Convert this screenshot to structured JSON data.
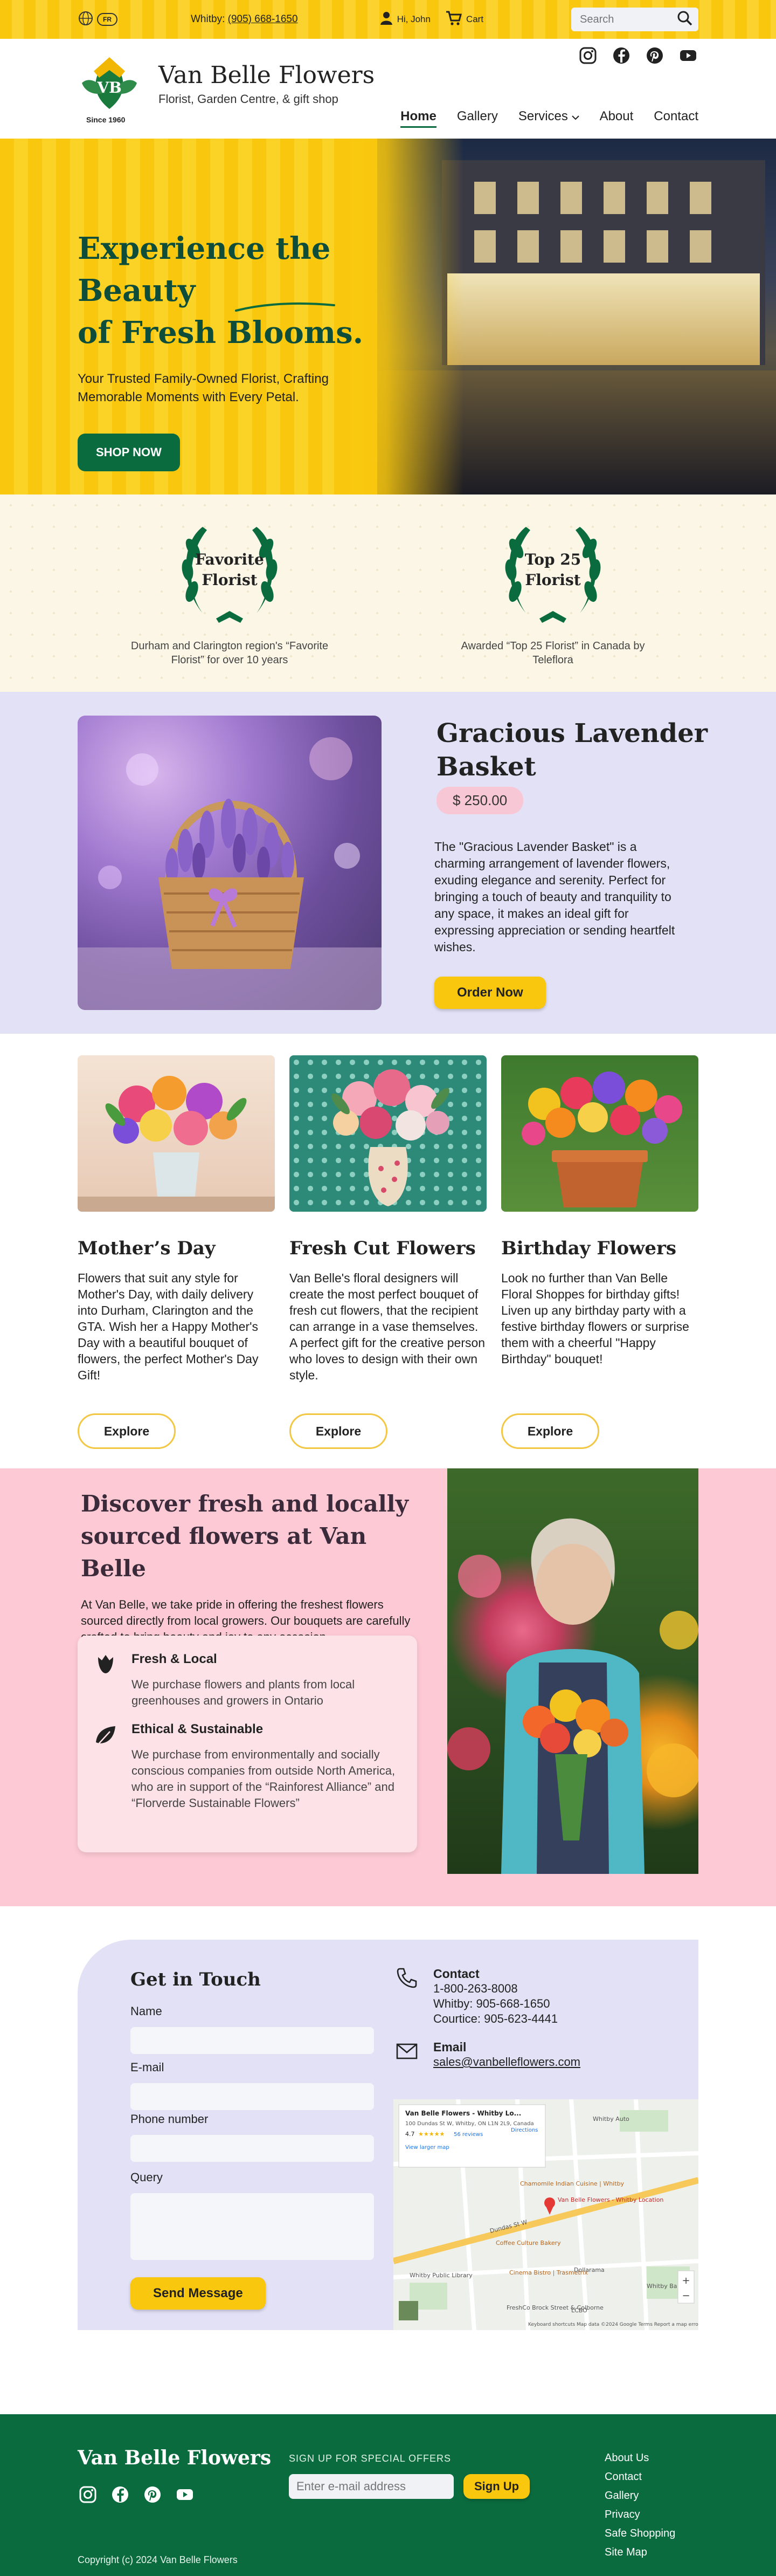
{
  "colors": {
    "brand_green": "#0a6b3e",
    "accent_yellow": "#f9c80e",
    "lavender_bg": "#e3e1f6",
    "pink_bg": "#fcc9d4"
  },
  "topbar": {
    "lang": "FR",
    "phone_prefix": "Whitby: ",
    "phone": "(905) 668-1650",
    "user": "Hi, John",
    "cart": "Cart",
    "search_placeholder": "Search"
  },
  "header": {
    "logo_letters": "VB",
    "since": "Since 1960",
    "name": "Van Belle Flowers",
    "tagline": "Florist, Garden Centre, & gift shop",
    "nav": [
      "Home",
      "Gallery",
      "Services",
      "About",
      "Contact"
    ]
  },
  "hero": {
    "title_line1": "Experience the Beauty",
    "title_line2": "of Fresh Blooms.",
    "subtitle": "Your Trusted Family-Owned Florist, Crafting Memorable Moments with Every Petal.",
    "cta": "SHOP NOW"
  },
  "awards": [
    {
      "badge_line1": "Favorite",
      "badge_line2": "Florist",
      "desc": "Durham and Clarington region's “Favorite Florist” for over 10 years"
    },
    {
      "badge_line1": "Top 25",
      "badge_line2": "Florist",
      "desc": "Awarded “Top 25 Florist” in Canada by Teleflora"
    }
  ],
  "featured": {
    "title": "Gracious Lavender Basket",
    "price": "$ 250.00",
    "desc": "The \"Gracious Lavender Basket\" is a charming arrangement of lavender flowers, exuding elegance and serenity. Perfect for bringing a touch of beauty and tranquility to any space, it makes an ideal gift for expressing appreciation or sending heartfelt wishes.",
    "cta": "Order Now"
  },
  "categories": [
    {
      "title": "Mother’s Day",
      "desc": "Flowers that suit any style for Mother's Day, with daily delivery into Durham, Clarington and the GTA.  Wish her a Happy Mother's Day with a beautiful bouquet of flowers, the perfect Mother's Day Gift!",
      "cta": "Explore"
    },
    {
      "title": "Fresh Cut Flowers",
      "desc": "Van Belle's floral designers will create the most perfect bouquet of fresh cut flowers, that the recipient can arrange in a vase themselves. A perfect gift for the creative person who loves to design with their own style.",
      "cta": "Explore"
    },
    {
      "title": "Birthday Flowers",
      "desc": "Look no further than Van Belle Floral Shoppes for birthday gifts! Liven up any birthday party with a festive birthday flowers or surprise them with a cheerful \"Happy Birthday\" bouquet!",
      "cta": "Explore"
    }
  ],
  "local": {
    "title": "Discover fresh and locally sourced flowers at Van Belle",
    "intro": "At Van Belle, we take pride in offering the freshest flowers sourced directly from local growers. Our bouquets are carefully crafted to bring beauty and joy to any occasion.",
    "items": [
      {
        "title": "Fresh & Local",
        "text": "We purchase flowers and plants from local greenhouses and growers in Ontario"
      },
      {
        "title": "Ethical & Sustainable",
        "text": "We purchase from environmentally and socially conscious companies from outside North America, who are in support of the “Rainforest Alliance” and “Florverde Sustainable Flowers”"
      }
    ]
  },
  "contact": {
    "title": "Get in Touch",
    "fields": [
      "Name",
      "E-mail",
      "Phone number",
      "Query"
    ],
    "send": "Send Message",
    "phone_title": "Contact",
    "phone_lines": [
      "1-800-263-8008",
      "Whitby: 905-668-1650",
      "Courtice: 905-623-4441"
    ],
    "email_title": "Email",
    "email": "sales@vanbelleflowers.com",
    "map": {
      "place": "Van Belle Flowers - Whitby Lo...",
      "address": "100 Dundas St W, Whitby, ON L1N 2L9, Canada",
      "rating": "4.7",
      "reviews": "56 reviews",
      "larger": "View larger map",
      "directions": "Directions",
      "pin_label": "Van Belle Flowers - Whitby Location",
      "street": "Dundas St W",
      "pois": [
        "Whitby Auto",
        "Chamomile Indian Cuisine | Whitby",
        "Coffee Culture Bakery",
        "Whitby Public Library",
        "Cinema Bistro | Trasmetrix",
        "Dollarama",
        "Whitby Bar",
        "LCBO",
        "FreshCo Brock Street & Colborne"
      ],
      "footer": "Keyboard shortcuts   Map data ©2024 Google   Terms   Report a map error"
    }
  },
  "footer": {
    "brand": "Van Belle Flowers",
    "signup_label": "SIGN UP FOR SPECIAL OFFERS",
    "signup_placeholder": "Enter e-mail address",
    "signup_btn": "Sign Up",
    "links": [
      "About Us",
      "Contact",
      "Gallery",
      "Privacy",
      "Safe Shopping",
      "Site Map"
    ],
    "copyright": "Copyright (c) 2024 Van Belle Flowers"
  }
}
